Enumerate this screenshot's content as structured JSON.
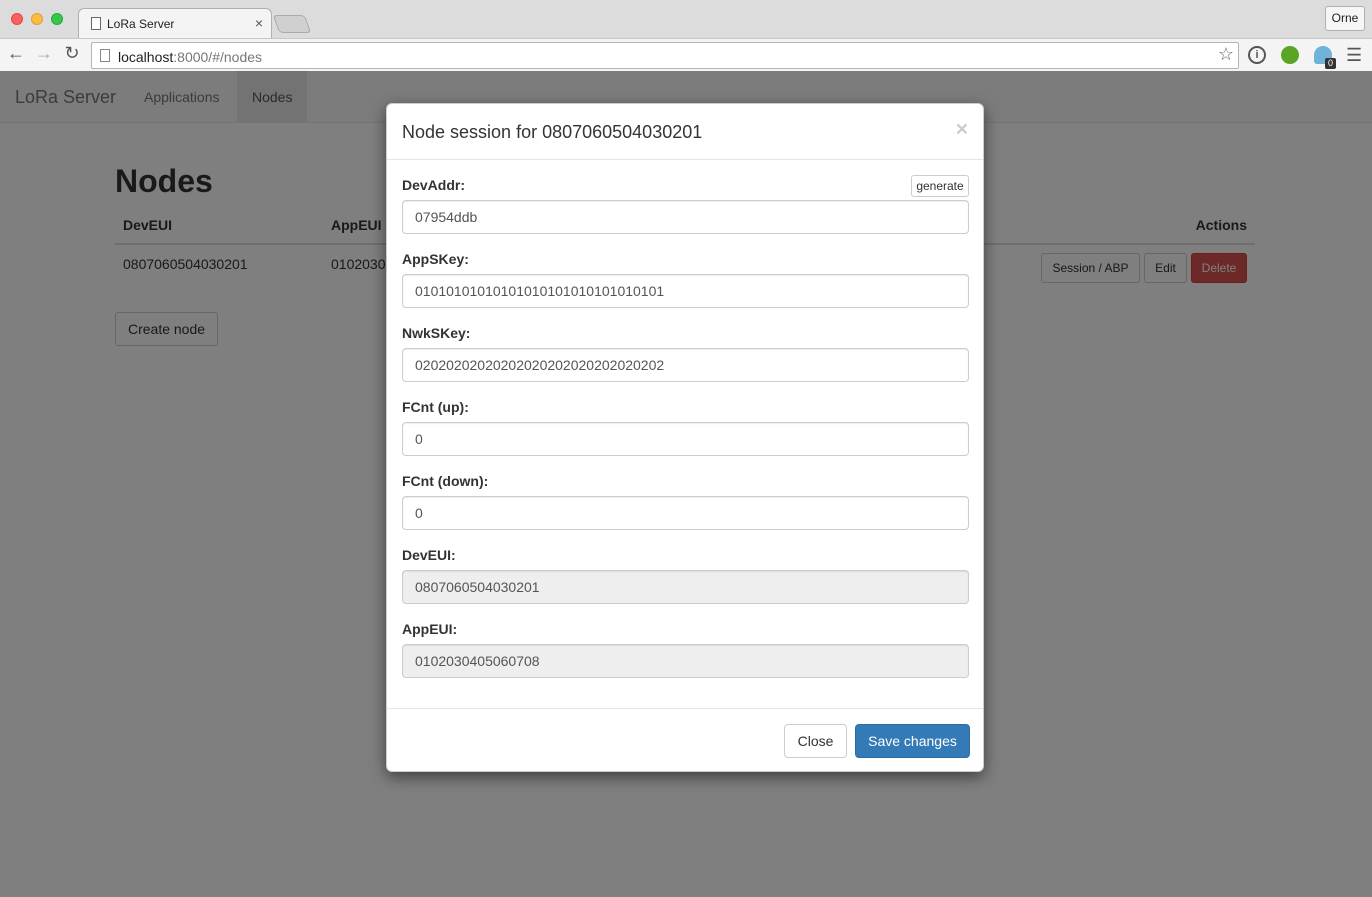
{
  "browser": {
    "tab_title": "LoRa Server",
    "tab_close": "×",
    "profile": "Orne",
    "url_host": "localhost",
    "url_rest": ":8000/#/nodes",
    "ext_badge": "0"
  },
  "navbar": {
    "brand": "LoRa Server",
    "links": [
      "Applications",
      "Nodes"
    ]
  },
  "page": {
    "title": "Nodes",
    "table": {
      "headers": [
        "DevEUI",
        "AppEUI",
        "Actions"
      ],
      "rows": [
        {
          "deveui": "0807060504030201",
          "appeui": "0102030"
        }
      ],
      "actions": {
        "session": "Session / ABP",
        "edit": "Edit",
        "delete": "Delete"
      }
    },
    "create_button": "Create node"
  },
  "modal": {
    "title": "Node session for 0807060504030201",
    "close_x": "×",
    "generate_label": "generate",
    "fields": [
      {
        "label": "DevAddr:",
        "value": "07954ddb",
        "readonly": false
      },
      {
        "label": "AppSKey:",
        "value": "01010101010101010101010101010101",
        "readonly": false
      },
      {
        "label": "NwkSKey:",
        "value": "02020202020202020202020202020202",
        "readonly": false
      },
      {
        "label": "FCnt (up):",
        "value": "0",
        "readonly": false
      },
      {
        "label": "FCnt (down):",
        "value": "0",
        "readonly": false
      },
      {
        "label": "DevEUI:",
        "value": "0807060504030201",
        "readonly": true
      },
      {
        "label": "AppEUI:",
        "value": "0102030405060708",
        "readonly": true
      }
    ],
    "close_button": "Close",
    "save_button": "Save changes"
  },
  "colors": {
    "primary": "#337ab7",
    "danger": "#d9534f"
  }
}
